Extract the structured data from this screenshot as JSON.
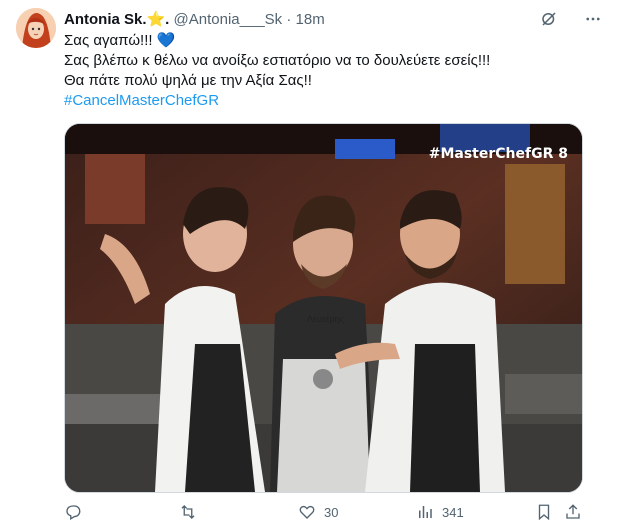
{
  "tweet": {
    "author_name": "Antonia Sk.⭐.",
    "handle": "@Antonia___Sk",
    "separator": "·",
    "time": "18m",
    "text_lines": [
      "Σας αγαπώ!!! 💙",
      "Σας βλέπω κ θέλω να ανοίξω εστιατόριο να το δουλεύετε εσείς!!!",
      "Θα πάτε πολύ ψηλά με την Αξία Σας!!"
    ],
    "hashtag": "#CancelMasterChefGR",
    "media_overlay_text": "#MasterChefGR",
    "media_overlay_number": "8",
    "apron_name": "Λευτέρης"
  },
  "actions": {
    "reply_count": "",
    "retweet_count": "",
    "like_count": "30",
    "views_count": "341"
  },
  "icons": {
    "grok": "grok-icon",
    "more": "more-icon",
    "reply": "reply-icon",
    "retweet": "retweet-icon",
    "like": "like-icon",
    "views": "views-icon",
    "bookmark": "bookmark-icon",
    "share": "share-icon"
  },
  "colors": {
    "text": "#0f1419",
    "secondary": "#536471",
    "link": "#1d9bf0"
  }
}
